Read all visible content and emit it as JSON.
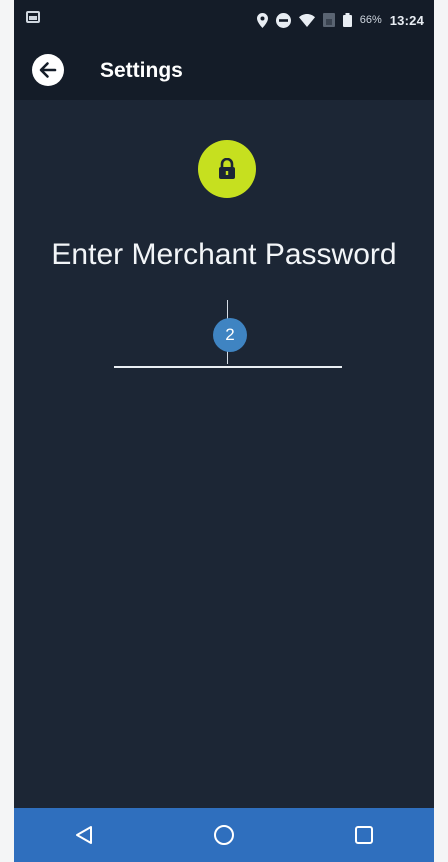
{
  "status_bar": {
    "battery_percent": "66%",
    "time": "13:24",
    "icons": [
      "image-notification-icon",
      "location-icon",
      "do-not-disturb-icon",
      "wifi-icon",
      "signal-icon",
      "battery-icon"
    ]
  },
  "header": {
    "title": "Settings",
    "back_icon": "back-arrow-icon"
  },
  "main": {
    "lock_icon": "lock-icon",
    "accent_color": "#c6e01f",
    "prompt": "Enter Merchant Password",
    "password_value": "",
    "step_badge": "2",
    "step_badge_color": "#3f84c2"
  },
  "nav_bar": {
    "color": "#2f6fbe",
    "buttons": [
      "back-nav-icon",
      "home-nav-icon",
      "recents-nav-icon"
    ]
  }
}
